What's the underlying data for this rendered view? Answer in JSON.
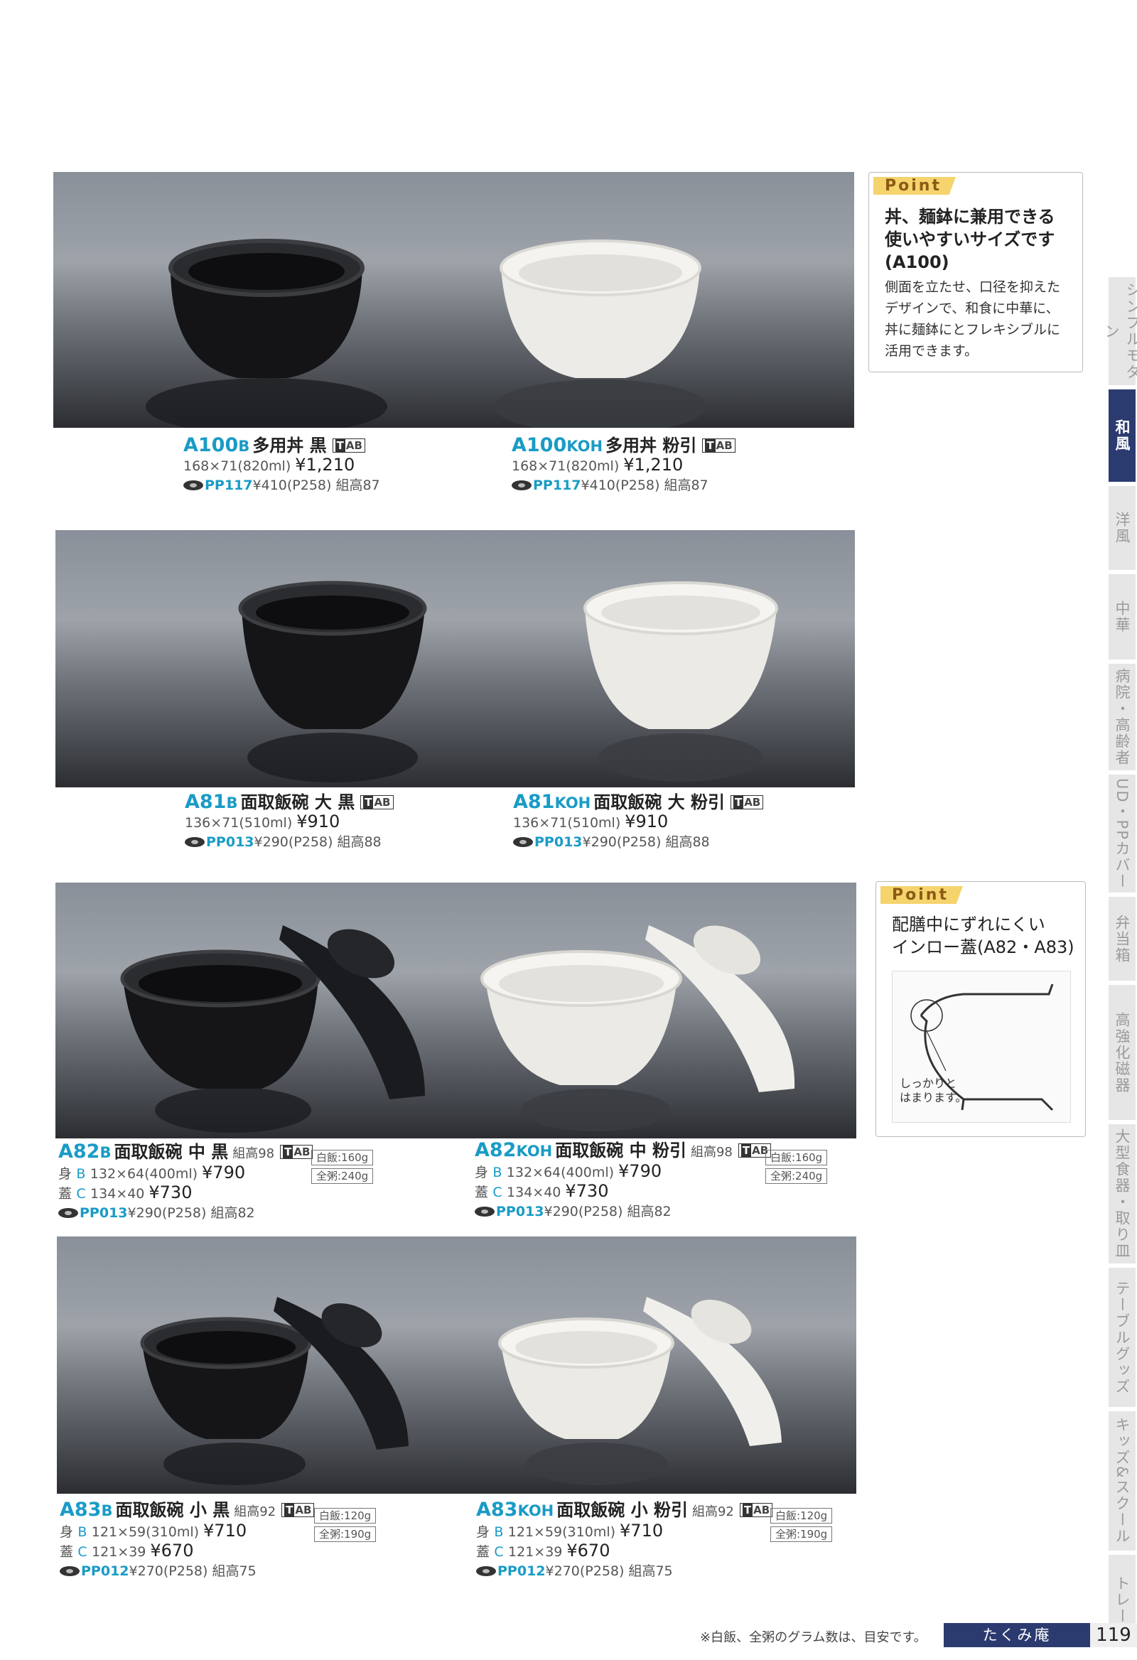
{
  "rows": [
    {
      "items": [
        {
          "code": "A100",
          "suffix": "B",
          "name": "多用丼 黒",
          "kumidaka": "",
          "tab": "AB",
          "dims": [
            "168×71(820ml)"
          ],
          "prices": [
            "¥1,210"
          ],
          "body_prefix": [
            ""
          ],
          "pp": "PP117",
          "pp_rest": "¥410(P258) 組高87",
          "weights": [],
          "color": "black"
        },
        {
          "code": "A100",
          "suffix": "KOH",
          "name": "多用丼 粉引",
          "kumidaka": "",
          "tab": "AB",
          "dims": [
            "168×71(820ml)"
          ],
          "prices": [
            "¥1,210"
          ],
          "body_prefix": [
            ""
          ],
          "pp": "PP117",
          "pp_rest": "¥410(P258) 組高87",
          "weights": [],
          "color": "white"
        }
      ]
    },
    {
      "items": [
        {
          "code": "A81",
          "suffix": "B",
          "name": "面取飯碗 大 黒",
          "kumidaka": "",
          "tab": "AB",
          "dims": [
            "136×71(510ml)"
          ],
          "prices": [
            "¥910"
          ],
          "body_prefix": [
            ""
          ],
          "pp": "PP013",
          "pp_rest": "¥290(P258) 組高88",
          "weights": [],
          "color": "black"
        },
        {
          "code": "A81",
          "suffix": "KOH",
          "name": "面取飯碗 大 粉引",
          "kumidaka": "",
          "tab": "AB",
          "dims": [
            "136×71(510ml)"
          ],
          "prices": [
            "¥910"
          ],
          "body_prefix": [
            ""
          ],
          "pp": "PP013",
          "pp_rest": "¥290(P258) 組高88",
          "weights": [],
          "color": "white"
        }
      ]
    },
    {
      "items": [
        {
          "code": "A82",
          "suffix": "B",
          "name": "面取飯碗 中 黒",
          "kumidaka": "組高98",
          "tab": "AB",
          "dims": [
            "132×64(400ml)",
            "134×40"
          ],
          "prices": [
            "¥790",
            "¥730"
          ],
          "body_prefix": [
            "身",
            "蓋"
          ],
          "body_letter": [
            "B",
            "C"
          ],
          "pp": "PP013",
          "pp_rest": "¥290(P258) 組高82",
          "weights": [
            "白飯:160g",
            "全粥:240g"
          ],
          "color": "black"
        },
        {
          "code": "A82",
          "suffix": "KOH",
          "name": "面取飯碗 中 粉引",
          "kumidaka": "組高98",
          "tab": "AB",
          "dims": [
            "132×64(400ml)",
            "134×40"
          ],
          "prices": [
            "¥790",
            "¥730"
          ],
          "body_prefix": [
            "身",
            "蓋"
          ],
          "body_letter": [
            "B",
            "C"
          ],
          "pp": "PP013",
          "pp_rest": "¥290(P258) 組高82",
          "weights": [
            "白飯:160g",
            "全粥:240g"
          ],
          "color": "white"
        }
      ]
    },
    {
      "items": [
        {
          "code": "A83",
          "suffix": "B",
          "name": "面取飯碗 小 黒",
          "kumidaka": "組高92",
          "tab": "AB",
          "dims": [
            "121×59(310ml)",
            "121×39"
          ],
          "prices": [
            "¥710",
            "¥670"
          ],
          "body_prefix": [
            "身",
            "蓋"
          ],
          "body_letter": [
            "B",
            "C"
          ],
          "pp": "PP012",
          "pp_rest": "¥270(P258) 組高75",
          "weights": [
            "白飯:120g",
            "全粥:190g"
          ],
          "color": "black"
        },
        {
          "code": "A83",
          "suffix": "KOH",
          "name": "面取飯碗 小 粉引",
          "kumidaka": "組高92",
          "tab": "AB",
          "dims": [
            "121×59(310ml)",
            "121×39"
          ],
          "prices": [
            "¥710",
            "¥670"
          ],
          "body_prefix": [
            "身",
            "蓋"
          ],
          "body_letter": [
            "B",
            "C"
          ],
          "pp": "PP012",
          "pp_rest": "¥270(P258) 組高75",
          "weights": [
            "白飯:120g",
            "全粥:190g"
          ],
          "color": "white"
        }
      ]
    }
  ],
  "points": [
    {
      "tag": "Point",
      "head": [
        "丼、麺鉢に兼用できる",
        "使いやすいサイズです",
        "(A100)"
      ],
      "body": [
        "側面を立たせ、口径を抑えた",
        "デザインで、和食に中華に、",
        "丼に麺鉢にとフレキシブルに",
        "活用できます。"
      ],
      "diagram_note": []
    },
    {
      "tag": "Point",
      "head": [
        "配膳中にずれにくい",
        "インロー蓋(A82・A83)"
      ],
      "body": [],
      "diagram_note": [
        "しっかりと",
        "はまります。"
      ]
    }
  ],
  "sidenav": [
    {
      "label": "シンプルモダン",
      "active": false
    },
    {
      "label": "和風",
      "active": true
    },
    {
      "label": "洋風",
      "active": false
    },
    {
      "label": "中華",
      "active": false
    },
    {
      "label": "病院・高齢者",
      "active": false
    },
    {
      "label": "UD・PPカバー",
      "active": false
    },
    {
      "label": "弁当箱",
      "active": false
    },
    {
      "label": "高強化磁器",
      "active": false
    },
    {
      "label": "大型食器・取り皿",
      "active": false
    },
    {
      "label": "テーブルグッズ",
      "active": false
    },
    {
      "label": "キッズ&スクール",
      "active": false
    },
    {
      "label": "トレー",
      "active": false
    }
  ],
  "footer": {
    "note": "※白飯、全粥のグラム数は、目安です。",
    "brand": "たくみ庵",
    "page": "119"
  }
}
